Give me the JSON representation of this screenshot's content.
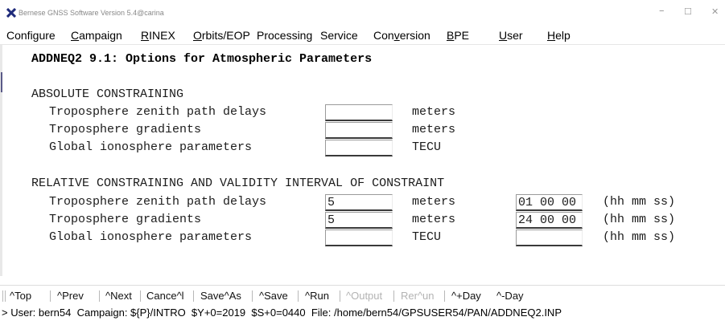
{
  "window": {
    "title": "Bernese GNSS Software Version 5.4@carina",
    "controls": {
      "minimize": "–",
      "maximize": "☐",
      "close": "✕"
    }
  },
  "menu": [
    {
      "label": "Configure"
    },
    {
      "label": "Campaign"
    },
    {
      "label": "RINEX"
    },
    {
      "label": "Orbits/EOP"
    },
    {
      "label": "Processing"
    },
    {
      "label": "Service"
    },
    {
      "label": "Conversion"
    },
    {
      "label": "BPE"
    },
    {
      "label": "User"
    },
    {
      "label": "Help"
    }
  ],
  "panel": {
    "heading": "ADDNEQ2 9.1: Options for Atmospheric Parameters",
    "absolute": {
      "title": "ABSOLUTE CONSTRAINING",
      "rows": [
        {
          "label": "Troposphere zenith path delays",
          "value": "",
          "unit": "meters"
        },
        {
          "label": "Troposphere gradients",
          "value": "",
          "unit": "meters"
        },
        {
          "label": "Global ionosphere parameters",
          "value": "",
          "unit": "TECU"
        }
      ]
    },
    "relative": {
      "title": "RELATIVE CONSTRAINING AND VALIDITY INTERVAL OF CONSTRAINT",
      "rows": [
        {
          "label": "Troposphere zenith path delays",
          "value": "5",
          "unit": "meters",
          "interval": "01 00 00",
          "format": "(hh mm ss)"
        },
        {
          "label": "Troposphere gradients",
          "value": "5",
          "unit": "meters",
          "interval": "24 00 00",
          "format": "(hh mm ss)"
        },
        {
          "label": "Global ionosphere parameters",
          "value": "",
          "unit": "TECU",
          "interval": "",
          "format": "(hh mm ss)"
        }
      ]
    }
  },
  "toolbar": [
    {
      "label": "^Top",
      "enabled": true
    },
    {
      "label": "^Prev",
      "enabled": true
    },
    {
      "label": "^Next",
      "enabled": true
    },
    {
      "label": "Cance^l",
      "enabled": true
    },
    {
      "label": "Save^As",
      "enabled": true
    },
    {
      "label": "^Save",
      "enabled": true
    },
    {
      "label": "^Run",
      "enabled": true
    },
    {
      "label": "^Output",
      "enabled": false
    },
    {
      "label": "Rer^un",
      "enabled": false
    },
    {
      "label": "^+Day",
      "enabled": true
    },
    {
      "label": "^-Day",
      "enabled": true
    }
  ],
  "status": "> User: bern54  Campaign: ${P}/INTRO  $Y+0=2019  $S+0=0440  File: /home/bern54/GPSUSER54/PAN/ADDNEQ2.INP"
}
